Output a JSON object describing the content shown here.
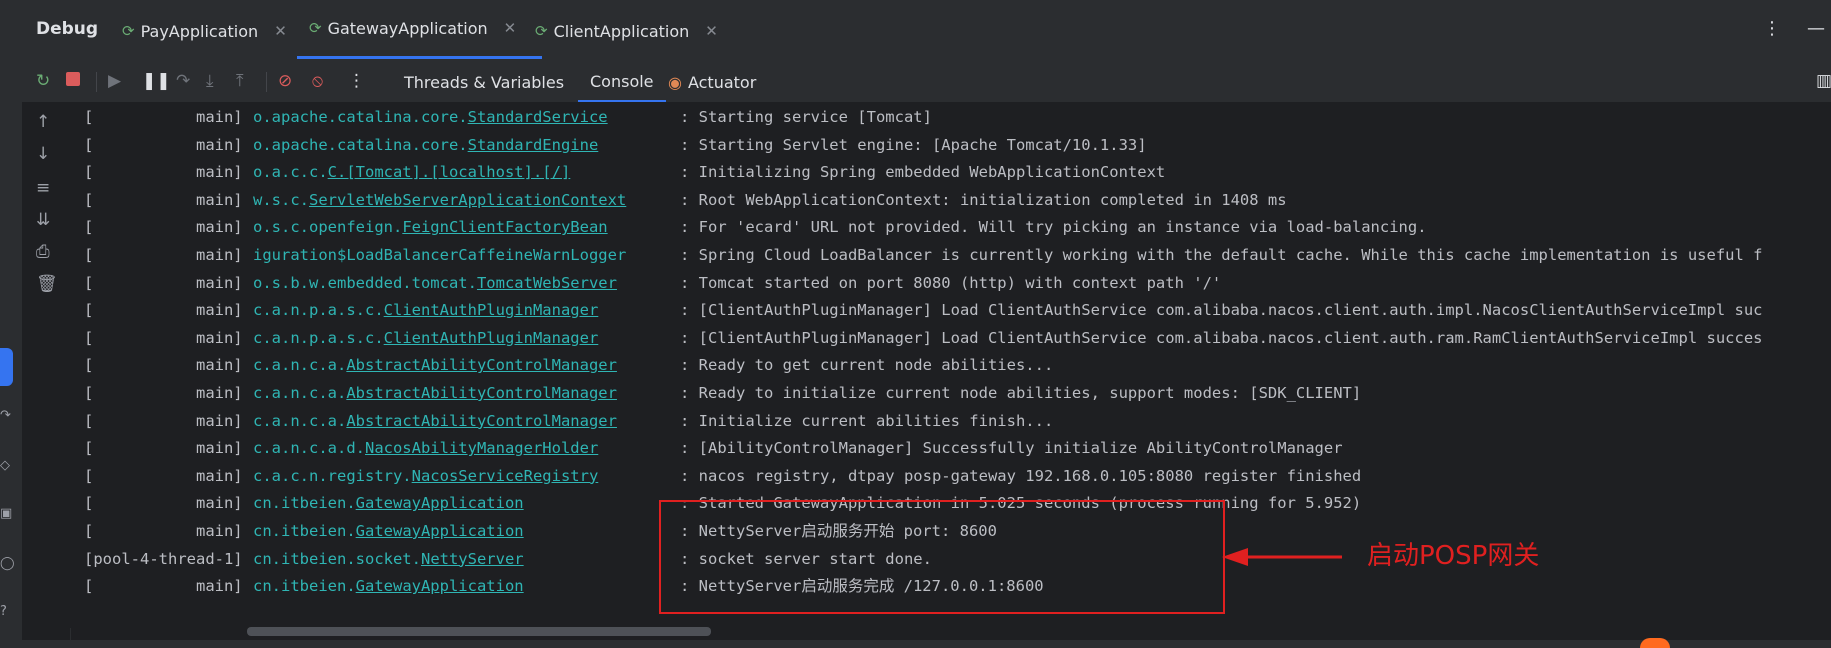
{
  "tabs_bar": {
    "title": "Debug",
    "tabs": [
      {
        "label": "PayApplication"
      },
      {
        "label": "GatewayApplication"
      },
      {
        "label": "ClientApplication"
      }
    ],
    "more_icon": "more-vertical-icon",
    "minimize_icon": "minimize-icon"
  },
  "toolbar": {
    "tabs": [
      {
        "label": "Threads & Variables"
      },
      {
        "label": "Console"
      },
      {
        "label": "Actuator"
      }
    ]
  },
  "console": {
    "lines": [
      {
        "thread": "[           main]",
        "logger_prefix": "o.apache.catalina.core.",
        "logger_class": "StandardService",
        "message": ": Starting service [Tomcat]"
      },
      {
        "thread": "[           main]",
        "logger_prefix": "o.apache.catalina.core.",
        "logger_class": "StandardEngine",
        "message": ": Starting Servlet engine: [Apache Tomcat/10.1.33]"
      },
      {
        "thread": "[           main]",
        "logger_prefix": "o.a.c.c.",
        "logger_class": "C.[Tomcat].[localhost].[/]",
        "message": ": Initializing Spring embedded WebApplicationContext"
      },
      {
        "thread": "[           main]",
        "logger_prefix": "w.s.c.",
        "logger_class": "ServletWebServerApplicationContext",
        "message": ": Root WebApplicationContext: initialization completed in 1408 ms"
      },
      {
        "thread": "[           main]",
        "logger_prefix": "o.s.c.openfeign.",
        "logger_class": "FeignClientFactoryBean",
        "message": ": For 'ecard' URL not provided. Will try picking an instance via load-balancing."
      },
      {
        "thread": "[           main]",
        "logger_prefix": "iguration$LoadBalancerCaffeineWarnLogger",
        "logger_class": "",
        "message": ": Spring Cloud LoadBalancer is currently working with the default cache. While this cache implementation is useful f"
      },
      {
        "thread": "[           main]",
        "logger_prefix": "o.s.b.w.embedded.tomcat.",
        "logger_class": "TomcatWebServer",
        "message": ": Tomcat started on port 8080 (http) with context path '/'"
      },
      {
        "thread": "[           main]",
        "logger_prefix": "c.a.n.p.a.s.c.",
        "logger_class": "ClientAuthPluginManager",
        "message": ": [ClientAuthPluginManager] Load ClientAuthService com.alibaba.nacos.client.auth.impl.NacosClientAuthServiceImpl suc"
      },
      {
        "thread": "[           main]",
        "logger_prefix": "c.a.n.p.a.s.c.",
        "logger_class": "ClientAuthPluginManager",
        "message": ": [ClientAuthPluginManager] Load ClientAuthService com.alibaba.nacos.client.auth.ram.RamClientAuthServiceImpl succes"
      },
      {
        "thread": "[           main]",
        "logger_prefix": "c.a.n.c.a.",
        "logger_class": "AbstractAbilityControlManager",
        "message": ": Ready to get current node abilities..."
      },
      {
        "thread": "[           main]",
        "logger_prefix": "c.a.n.c.a.",
        "logger_class": "AbstractAbilityControlManager",
        "message": ": Ready to initialize current node abilities, support modes: [SDK_CLIENT]"
      },
      {
        "thread": "[           main]",
        "logger_prefix": "c.a.n.c.a.",
        "logger_class": "AbstractAbilityControlManager",
        "message": ": Initialize current abilities finish..."
      },
      {
        "thread": "[           main]",
        "logger_prefix": "c.a.n.c.a.d.",
        "logger_class": "NacosAbilityManagerHolder",
        "message": ": [AbilityControlManager] Successfully initialize AbilityControlManager"
      },
      {
        "thread": "[           main]",
        "logger_prefix": "c.a.c.n.registry.",
        "logger_class": "NacosServiceRegistry",
        "message": ": nacos registry, dtpay posp-gateway 192.168.0.105:8080 register finished"
      },
      {
        "thread": "[           main]",
        "logger_prefix": "cn.itbeien.",
        "logger_class": "GatewayApplication",
        "message": ": Started GatewayApplication in 5.025 seconds (process running for 5.952)"
      },
      {
        "thread": "[           main]",
        "logger_prefix": "cn.itbeien.",
        "logger_class": "GatewayApplication",
        "message": ": NettyServer启动服务开始 port: 8600"
      },
      {
        "thread": "[pool-4-thread-1]",
        "logger_prefix": "cn.itbeien.socket.",
        "logger_class": "NettyServer",
        "message": ": socket server start done."
      },
      {
        "thread": "[           main]",
        "logger_prefix": "cn.itbeien.",
        "logger_class": "GatewayApplication",
        "message": ": NettyServer启动服务完成 /127.0.0.1:8600"
      }
    ]
  },
  "annotation": {
    "text": "启动POSP网关",
    "color": "#e02020"
  },
  "colors": {
    "accent": "#3574f0",
    "logger": "#2fb5b4",
    "run_icon": "#6aab73"
  }
}
